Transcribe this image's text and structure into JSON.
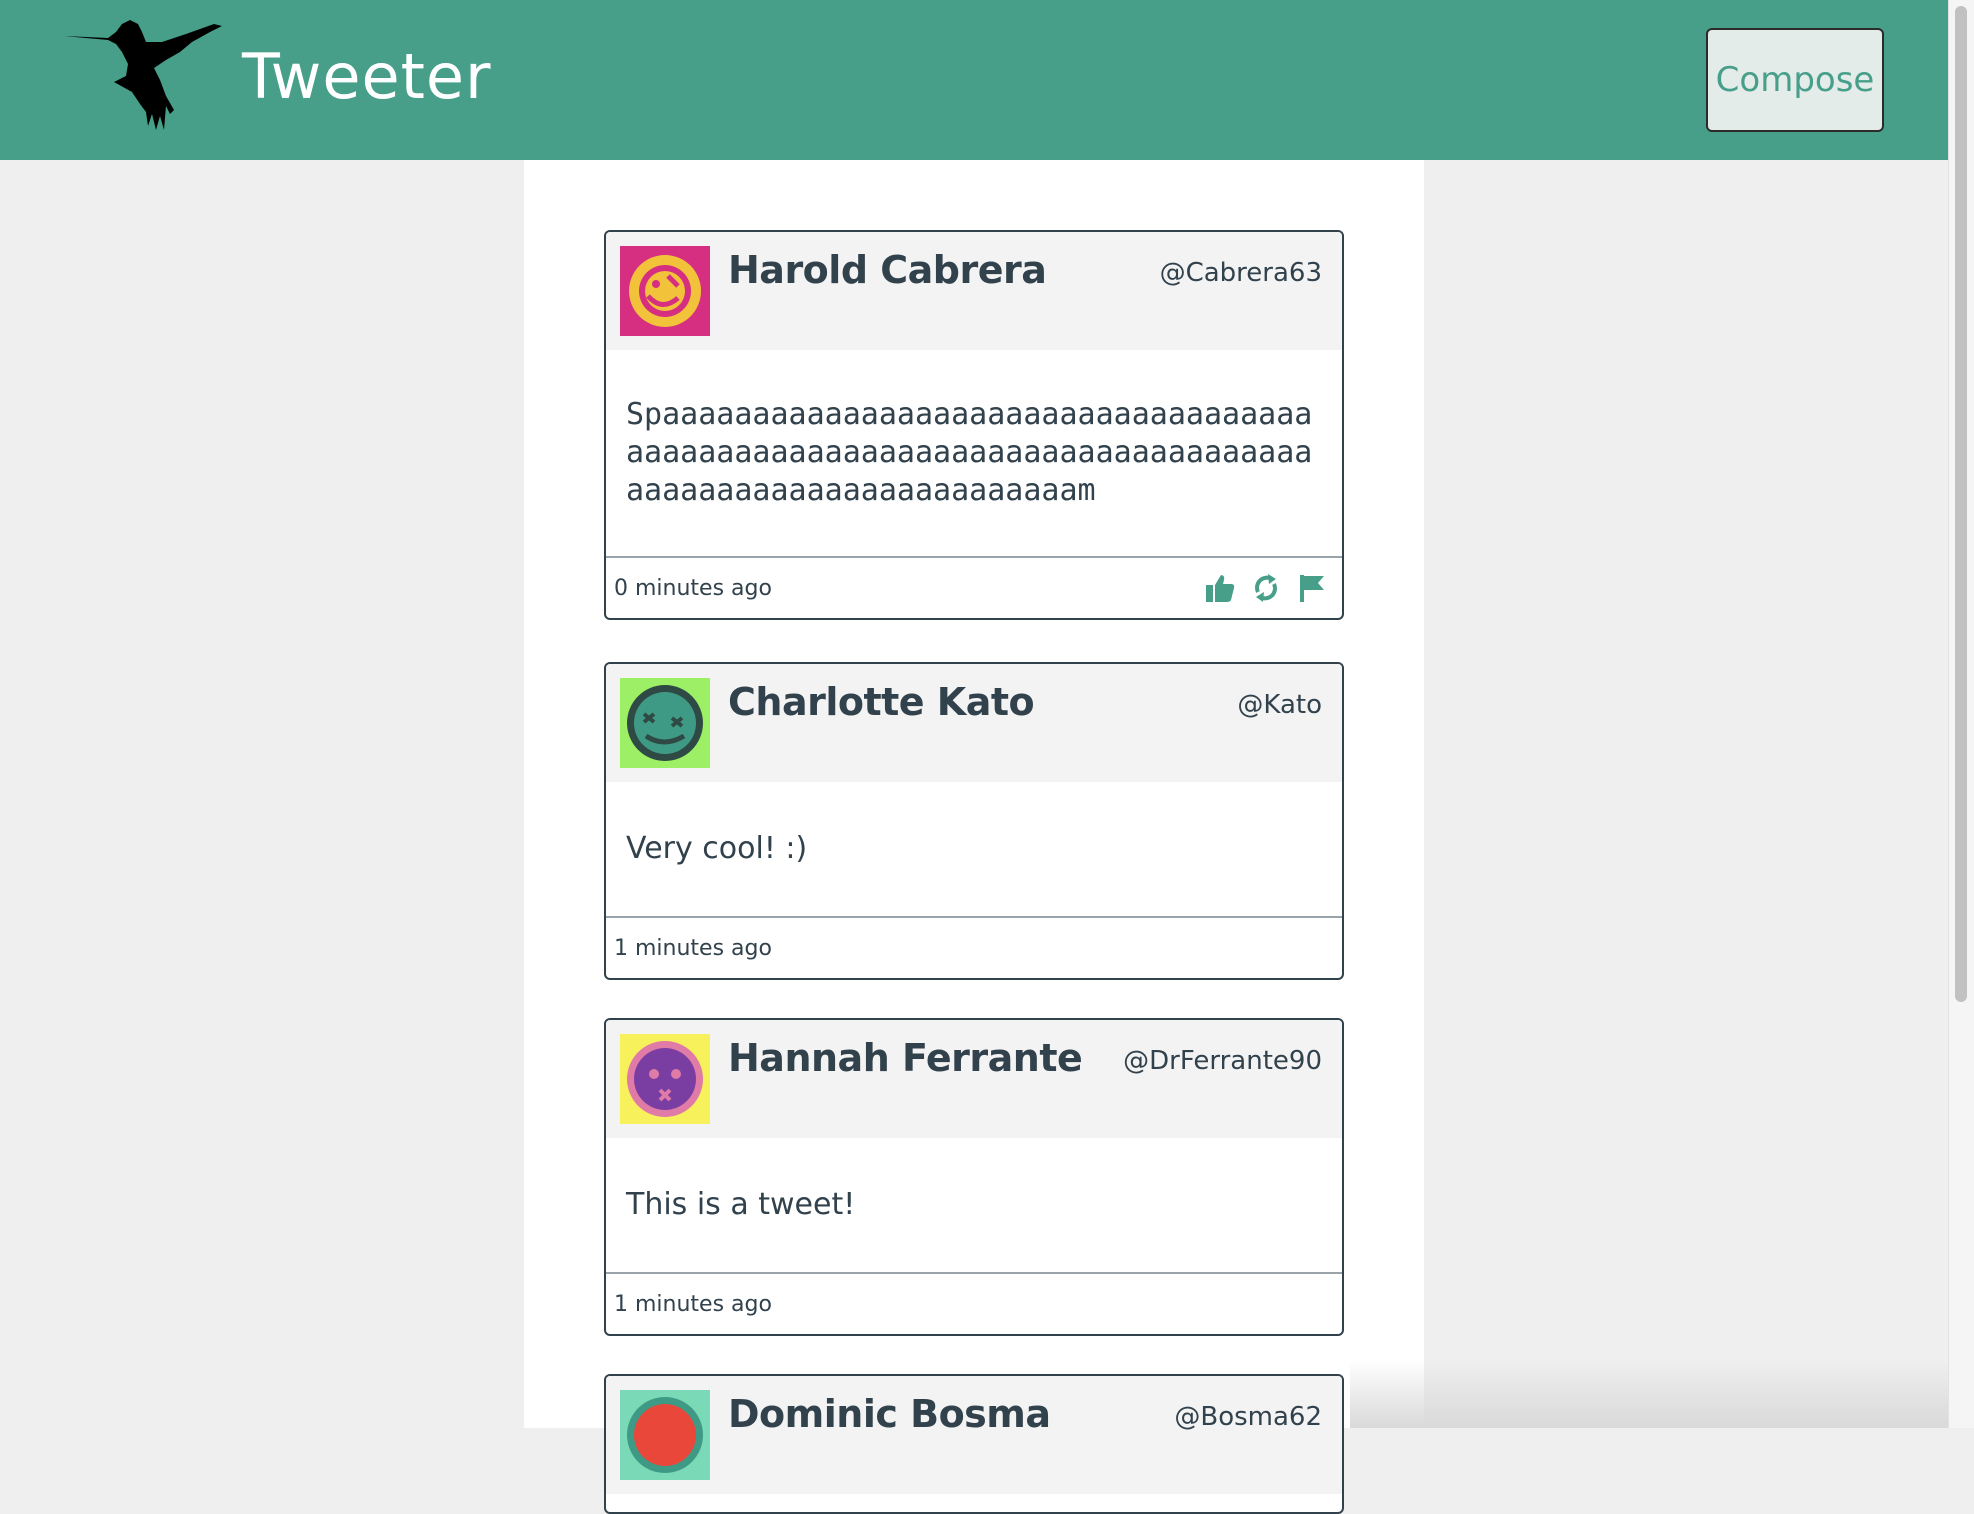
{
  "header": {
    "brand": "Tweeter",
    "compose_label": "Compose"
  },
  "tweets": [
    {
      "name": "Harold Cabrera",
      "handle": "@Cabrera63",
      "text": "Spaaaaaaaaaaaaaaaaaaaaaaaaaaaaaaaaaaaaaaaaaaaaaaaaaaaaaaaaaaaaaaaaaaaaaaaaaaaaaaaaaaaaaaaaaaaaaaaaaaam",
      "time": "0 minutes ago",
      "avatar_bg": "#d62f82",
      "avatar_face": "#f1c23a",
      "has_actions": true
    },
    {
      "name": "Charlotte Kato",
      "handle": "@Kato",
      "text": "Very cool! :)",
      "time": "1 minutes ago",
      "avatar_bg": "#9df066",
      "avatar_face": "#3f9a85",
      "has_actions": false
    },
    {
      "name": "Hannah Ferrante",
      "handle": "@DrFerrante90",
      "text": "This is a tweet!",
      "time": "1 minutes ago",
      "avatar_bg": "#f7f25c",
      "avatar_face": "#7a3ea3",
      "has_actions": false
    },
    {
      "name": "Dominic Bosma",
      "handle": "@Bosma62",
      "avatar_bg": "#7ad9b6",
      "avatar_face": "#e9473a"
    }
  ],
  "colors": {
    "accent": "#479f8a",
    "text": "#32424d"
  },
  "icons": [
    "hummingbird-logo-icon",
    "like-icon",
    "retweet-icon",
    "flag-icon"
  ]
}
